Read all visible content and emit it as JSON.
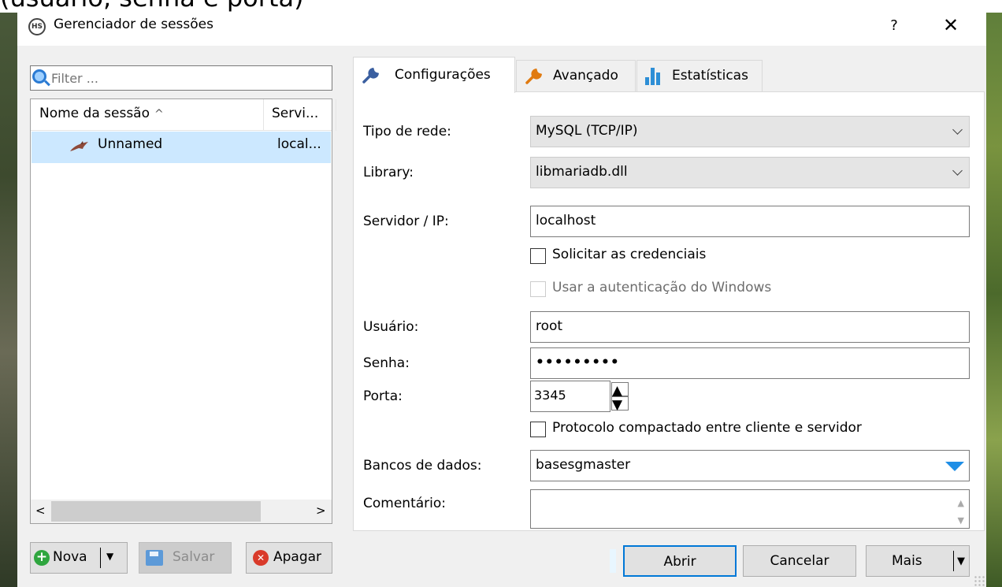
{
  "window": {
    "title": "Gerenciador de sessões",
    "help_glyph": "?",
    "close_glyph": "✕",
    "app_icon_text": "HS"
  },
  "clipped_top_text": "(usuário, senha e porta)",
  "filter": {
    "placeholder": "Filter ..."
  },
  "session_list": {
    "columns": [
      "Nome da sessão",
      "Servi..."
    ],
    "sort_indicator": "^",
    "rows": [
      {
        "name": "Unnamed",
        "server": "local...",
        "selected": true
      }
    ],
    "scroll_left": "<",
    "scroll_right": ">"
  },
  "left_buttons": {
    "nova": "Nova",
    "salvar": "Salvar",
    "apagar": "Apagar"
  },
  "tabs": [
    {
      "label": "Configurações",
      "active": true,
      "icon": "wrench-icon"
    },
    {
      "label": "Avançado",
      "active": false,
      "icon": "wrench-orange-icon"
    },
    {
      "label": "Estatísticas",
      "active": false,
      "icon": "bar-chart-icon"
    }
  ],
  "form": {
    "tipo_rede": {
      "label": "Tipo de rede:",
      "value": "MySQL (TCP/IP)"
    },
    "library": {
      "label": "Library:",
      "value": "libmariadb.dll"
    },
    "servidor": {
      "label": "Servidor / IP:",
      "value": "localhost"
    },
    "solicitar": {
      "label": "Solicitar as credenciais",
      "checked": false
    },
    "windows_auth": {
      "label": "Usar a autenticação do Windows",
      "checked": false,
      "disabled": true
    },
    "usuario": {
      "label": "Usuário:",
      "value": "root"
    },
    "senha": {
      "label": "Senha:",
      "value": "•••••••••"
    },
    "porta": {
      "label": "Porta:",
      "value": "3345",
      "up": "▲",
      "down": "▼"
    },
    "protocolo": {
      "label": "Protocolo compactado entre cliente e servidor",
      "checked": false
    },
    "bancos": {
      "label": "Bancos de dados:",
      "value": "basesgmaster"
    },
    "comentario": {
      "label": "Comentário:",
      "value": ""
    }
  },
  "bottom_buttons": {
    "abrir": "Abrir",
    "cancelar": "Cancelar",
    "mais": "Mais"
  },
  "colors": {
    "selected_row": "#cce8ff",
    "accent": "#0078d7",
    "dropdown_arrow": "#1e8ee6"
  }
}
